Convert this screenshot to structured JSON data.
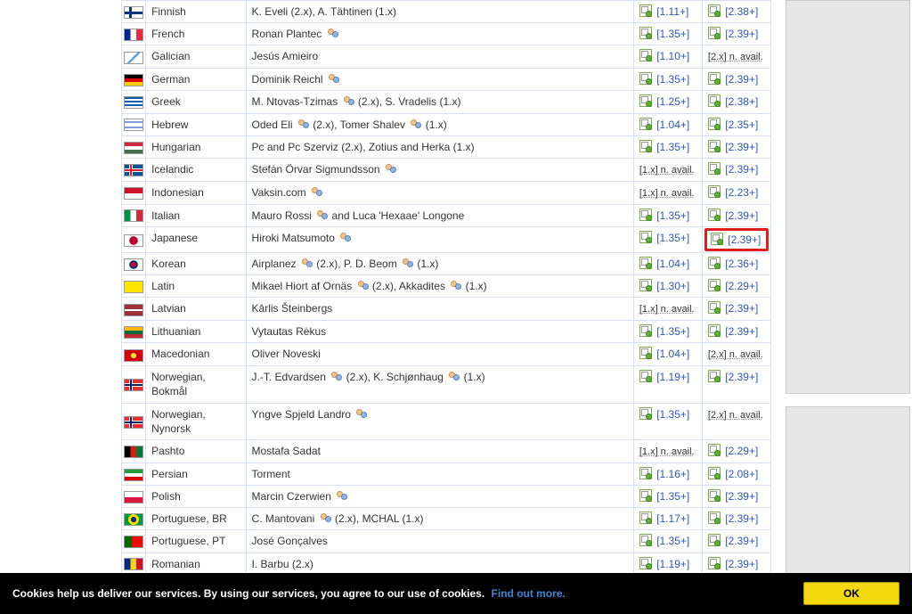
{
  "cookie": {
    "text": "Cookies help us deliver our services. By using our services, you agree to our use of cookies.",
    "link": "Find out more.",
    "ok": "OK"
  },
  "na1": "[1.x] n. avail.",
  "na2": "[2.x] n. avail.",
  "rows": [
    {
      "lang": "Finnish",
      "flag": "linear-gradient(#fff,#fff)",
      "flagExtra": "fin",
      "author": "K. Eveli (2.x), A. Tähtinen (1.x)",
      "v1": "[1.11+]",
      "v2": "[2.38+]"
    },
    {
      "lang": "French",
      "flag": "linear-gradient(90deg,#002395 33%,#fff 33% 66%,#ED2939 66%)",
      "author": "Ronan Plantec",
      "person": true,
      "v1": "[1.35+]",
      "v2": "[2.39+]"
    },
    {
      "lang": "Galician",
      "flag": "linear-gradient(135deg,#fff 45%,#5aa0e6 45% 55%,#fff 55%)",
      "author": "Jesús Amieiro",
      "v1": "[1.10+]",
      "v2": "na"
    },
    {
      "lang": "German",
      "flag": "linear-gradient(#000 33%,#DD0000 33% 66%,#FFCE00 66%)",
      "author": "Dominik Reichl",
      "person": true,
      "v1": "[1.35+]",
      "v2": "[2.39+]"
    },
    {
      "lang": "Greek",
      "flag": "repeating-linear-gradient(#0D5EAF 0 2px,#fff 2px 4px)",
      "author": "M. Ntovas-Tzimas _P_ (2.x), S. Vradelis (1.x)",
      "v1": "[1.25+]",
      "v2": "[2.38+]"
    },
    {
      "lang": "Hebrew",
      "flag": "linear-gradient(#fff 20%,#0038b8 20% 30%,#fff 30% 70%,#0038b8 70% 80%,#fff 80%)",
      "author": "Oded Eli _P_ (2.x), Tomer Shalev _P_ (1.x)",
      "v1": "[1.04+]",
      "v2": "[2.35+]"
    },
    {
      "lang": "Hungarian",
      "flag": "linear-gradient(#cd2a3e 33%,#fff 33% 66%,#436f4d 66%)",
      "author": "Pc and Pc Szerviz (2.x), Zotius and Herka (1.x)",
      "v1": "[1.35+]",
      "v2": "[2.39+]"
    },
    {
      "lang": "Icelandic",
      "flag": "linear-gradient(#02529C,#02529C)",
      "flagExtra": "ice",
      "author": "Stefán Örvar Sigmundsson",
      "person": true,
      "v1": "na",
      "v2": "[2.39+]"
    },
    {
      "lang": "Indonesian",
      "flag": "linear-gradient(#ce1126 50%,#fff 50%)",
      "author": "Vaksin.com",
      "person": true,
      "v1": "na",
      "v2": "[2.23+]"
    },
    {
      "lang": "Italian",
      "flag": "linear-gradient(90deg,#009246 33%,#fff 33% 66%,#ce2b37 66%)",
      "author": "Mauro Rossi _P_ and Luca 'Hexaae' Longone",
      "v1": "[1.35+]",
      "v2": "[2.39+]"
    },
    {
      "lang": "Japanese",
      "flag": "radial-gradient(circle at center,#bc002d 40%,#fff 42%)",
      "author": "Hiroki Matsumoto",
      "person": true,
      "v1": "[1.35+]",
      "v2": "[2.39+]",
      "highlight": true
    },
    {
      "lang": "Korean",
      "flag": "radial-gradient(circle at center,#c60c30 25%,#003478 25% 40%,#fff 42%)",
      "author": "Airplanez _P_ (2.x), P. D. Beom _P_ (1.x)",
      "v1": "[1.04+]",
      "v2": "[2.36+]"
    },
    {
      "lang": "Latin",
      "flag": "linear-gradient(#ffe600,#ffe600)",
      "author": "Mikael Hiort af Ornäs _P_ (2.x), Akkadites _P_ (1.x)",
      "v1": "[1.30+]",
      "v2": "[2.29+]"
    },
    {
      "lang": "Latvian",
      "flag": "linear-gradient(#9e3039 40%,#fff 40% 60%,#9e3039 60%)",
      "author": "Kārlis Šteinbergs",
      "v1": "na",
      "v2": "[2.39+]"
    },
    {
      "lang": "Lithuanian",
      "flag": "linear-gradient(#fdb913 33%,#006a44 33% 66%,#c1272d 66%)",
      "author": "Vytautas Rėkus",
      "v1": "[1.35+]",
      "v2": "[2.39+]"
    },
    {
      "lang": "Macedonian",
      "flag": "radial-gradient(circle at center,#f8e92e 25%,#d20000 27%)",
      "author": "Oliver Noveski",
      "v1": "[1.04+]",
      "v2": "na"
    },
    {
      "lang": "Norwegian, Bokmål",
      "flag": "linear-gradient(#ef2b2d,#ef2b2d)",
      "flagExtra": "nor",
      "author": "J.-T. Edvardsen _P_ (2.x), K. Schjønhaug _P_ (1.x)",
      "v1": "[1.19+]",
      "v2": "[2.39+]"
    },
    {
      "lang": "Norwegian, Nynorsk",
      "flag": "linear-gradient(#ef2b2d,#ef2b2d)",
      "flagExtra": "nor",
      "author": "Yngve Spjeld Landro",
      "person": true,
      "v1": "[1.35+]",
      "v2": "na"
    },
    {
      "lang": "Pashto",
      "flag": "linear-gradient(90deg,#000 33%,#d32011 33% 66%,#007a36 66%)",
      "author": "Mostafa Sadat",
      "v1": "na",
      "v2": "[2.29+]"
    },
    {
      "lang": "Persian",
      "flag": "linear-gradient(#239f40 33%,#fff 33% 66%,#da0000 66%)",
      "author": "Torment",
      "v1": "[1.16+]",
      "v2": "[2.08+]"
    },
    {
      "lang": "Polish",
      "flag": "linear-gradient(#fff 50%,#dc143c 50%)",
      "author": "Marcin Czerwien",
      "person": true,
      "v1": "[1.35+]",
      "v2": "[2.39+]"
    },
    {
      "lang": "Portuguese, BR",
      "flag": "radial-gradient(circle at center,#002776 25%,#ffdf00 27% 50%,#009b3a 52%)",
      "author": "C. Mantovani _P_ (2.x), MCHAL (1.x)",
      "v1": "[1.17+]",
      "v2": "[2.39+]"
    },
    {
      "lang": "Portuguese, PT",
      "flag": "linear-gradient(90deg,#006600 40%,#ff0000 40%)",
      "author": "José Gonçalves",
      "v1": "[1.35+]",
      "v2": "[2.39+]"
    },
    {
      "lang": "Romanian",
      "flag": "linear-gradient(90deg,#002b7f 33%,#fcd116 33% 66%,#ce1126 66%)",
      "author": "I. Barbu (2.x)",
      "v1": "[1.19+]",
      "v2": "[2.39+]"
    }
  ]
}
